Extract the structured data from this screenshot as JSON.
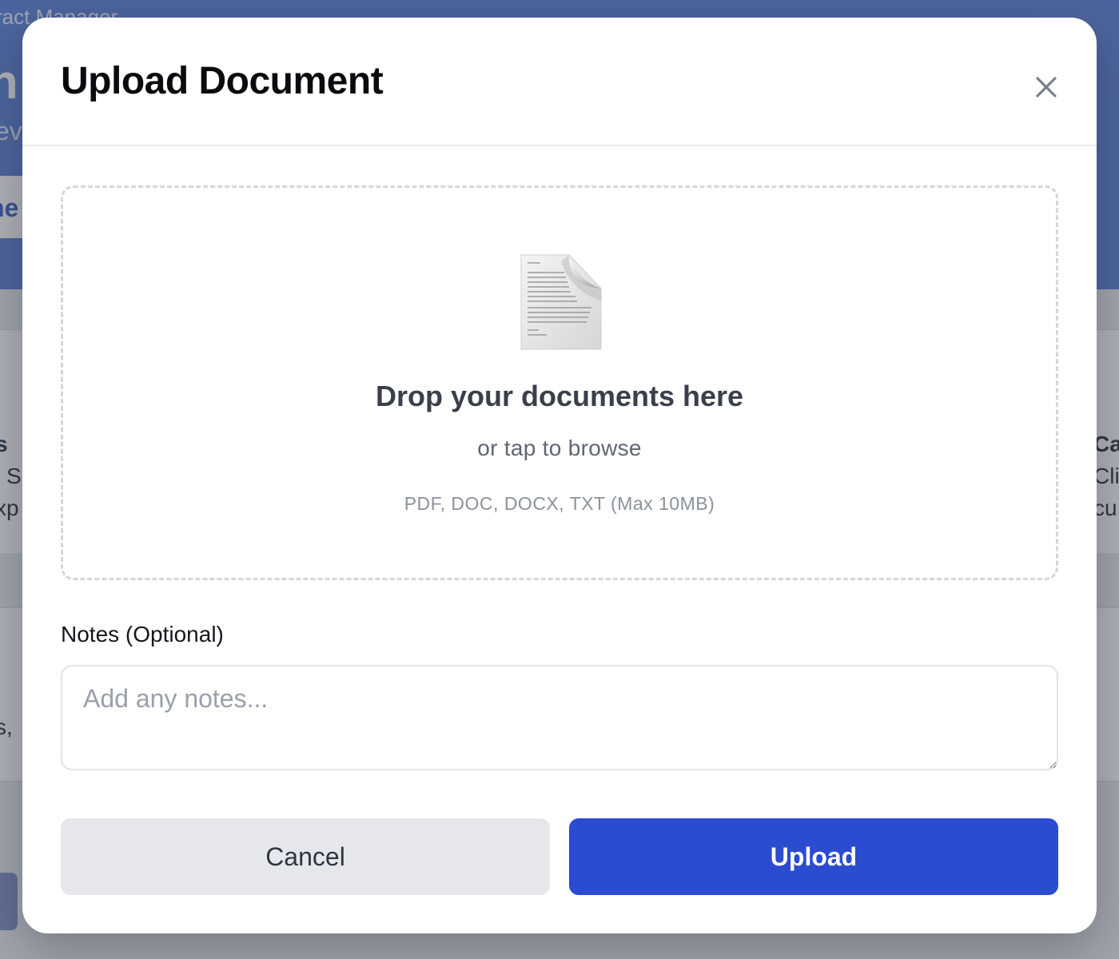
{
  "background": {
    "app_name": "ract Manager",
    "big_title": "n",
    "subtitle": "ev",
    "header_link": "s",
    "active_tab": "ne",
    "left_card_1": [
      "s",
      "l S",
      "xp"
    ],
    "left_card_2": [
      "s,"
    ],
    "right_card_1": [
      "Ca",
      "Cli",
      "cu"
    ]
  },
  "modal": {
    "title": "Upload Document",
    "close_icon": "close-icon"
  },
  "dropzone": {
    "icon": "document-icon",
    "title": "Drop your documents here",
    "subtitle": "or tap to browse",
    "formats": "PDF, DOC, DOCX, TXT (Max 10MB)"
  },
  "notes": {
    "label": "Notes (Optional)",
    "placeholder": "Add any notes...",
    "value": ""
  },
  "actions": {
    "cancel_label": "Cancel",
    "upload_label": "Upload"
  },
  "colors": {
    "accent": "#2b4bd0",
    "header_bg": "#5b7fd6",
    "cancel_bg": "#e5e7eb"
  }
}
